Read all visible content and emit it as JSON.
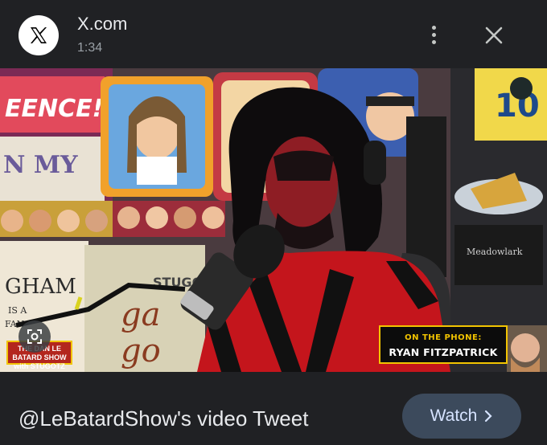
{
  "header": {
    "app_name": "X.com",
    "time": "1:34",
    "icons": {
      "app": "x-logo-icon",
      "menu": "more-vert-icon",
      "close": "close-icon"
    }
  },
  "video": {
    "lower_third": {
      "top_text": "ON THE PHONE:",
      "name": "RYAN FITZPATRICK"
    },
    "show_logo_text": "THE DAN LE BATARD SHOW with STUGOTZ",
    "background_signs": [
      "FENCE!",
      "GHAM",
      "IS A FAN",
      "STUGOTZ",
      "Meadowlark",
      "10"
    ],
    "lens_icon": "lens-search-icon",
    "colors": {
      "accent_yellow": "#f2c400",
      "shirt_red": "#c4151c"
    }
  },
  "footer": {
    "caption": "@LeBatardShow's video Tweet",
    "watch_label": "Watch",
    "watch_icon": "chevron-right-icon"
  }
}
